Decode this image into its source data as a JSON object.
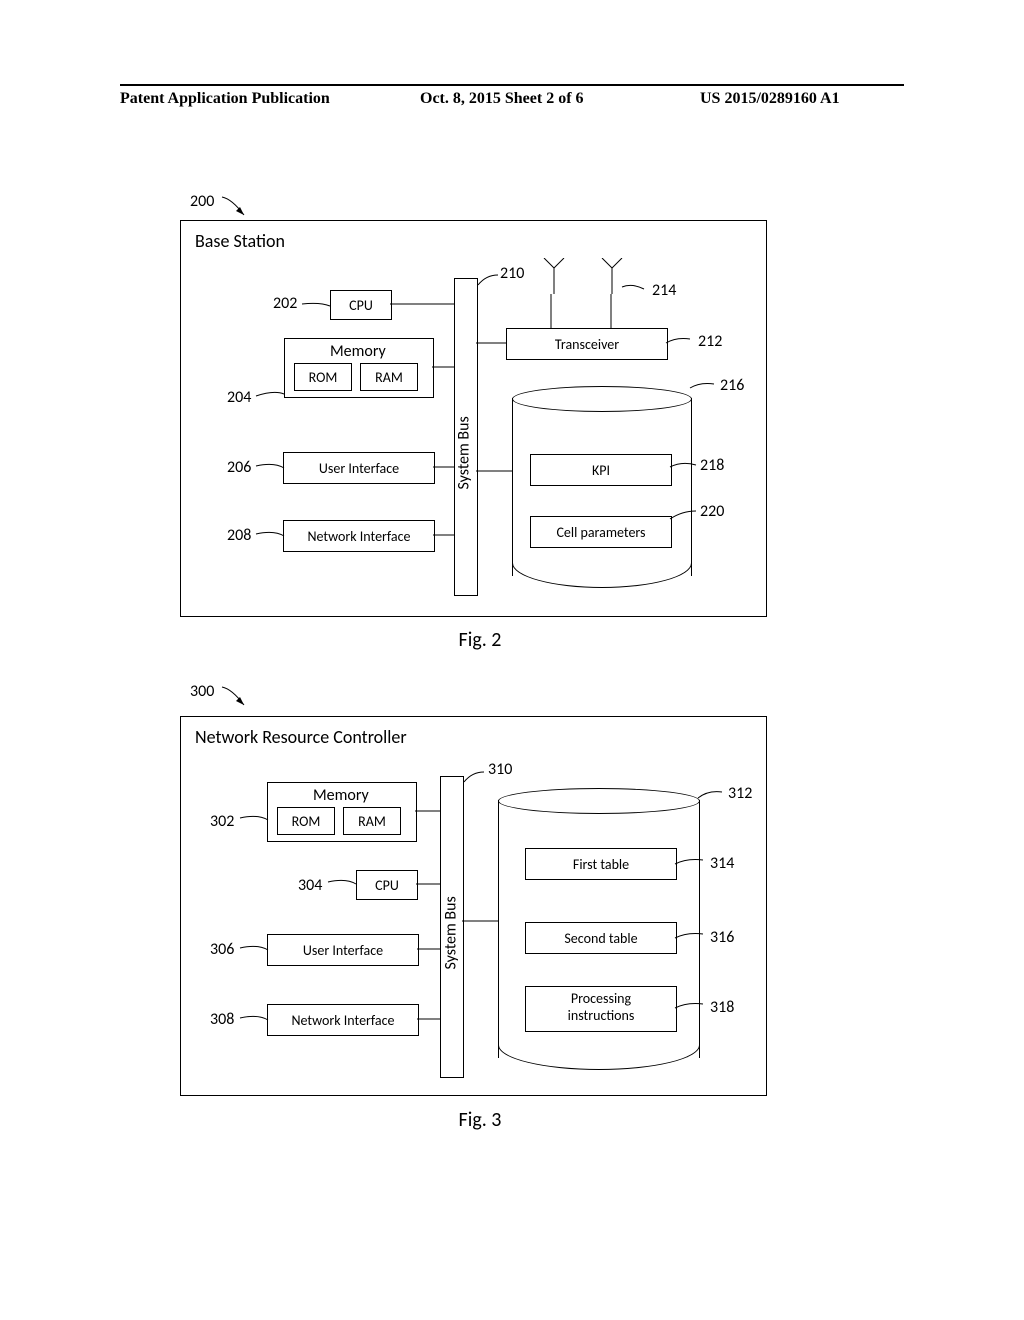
{
  "header": {
    "left": "Patent Application Publication",
    "mid": "Oct. 8, 2015   Sheet 2 of 6",
    "right": "US 2015/0289160 A1"
  },
  "fig2": {
    "refnum_pointer": "200",
    "title": "Base Station",
    "caption": "Fig. 2",
    "blocks": {
      "cpu": "CPU",
      "memory": "Memory",
      "rom": "ROM",
      "ram": "RAM",
      "ui": "User Interface",
      "netif": "Network Interface",
      "sysbus": "System Bus",
      "transceiver": "Transceiver",
      "kpi": "KPI",
      "cellparams": "Cell parameters"
    },
    "refs": {
      "r200": "200",
      "r202": "202",
      "r204": "204",
      "r206": "206",
      "r208": "208",
      "r210": "210",
      "r212": "212",
      "r214": "214",
      "r216": "216",
      "r218": "218",
      "r220": "220"
    }
  },
  "fig3": {
    "refnum_pointer": "300",
    "title": "Network Resource Controller",
    "caption": "Fig. 3",
    "blocks": {
      "memory": "Memory",
      "rom": "ROM",
      "ram": "RAM",
      "cpu": "CPU",
      "ui": "User Interface",
      "netif": "Network Interface",
      "sysbus": "System Bus",
      "first_table": "First table",
      "second_table": "Second table",
      "proc_instr_line1": "Processing",
      "proc_instr_line2": "instructions"
    },
    "refs": {
      "r300": "300",
      "r302": "302",
      "r304": "304",
      "r306": "306",
      "r308": "308",
      "r310": "310",
      "r312": "312",
      "r314": "314",
      "r316": "316",
      "r318": "318"
    }
  }
}
